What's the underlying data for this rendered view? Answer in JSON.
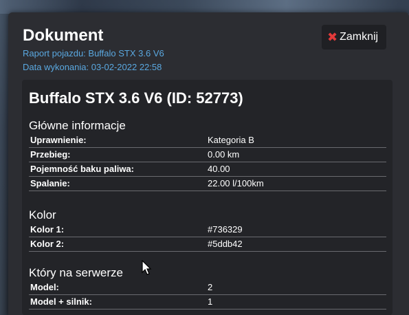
{
  "dialog": {
    "title": "Dokument",
    "report_line": "Raport pojazdu: Buffalo STX 3.6 V6",
    "date_line": "Data wykonania: 03-02-2022 22:58",
    "close_label": "Zamknij",
    "close_icon": "close-icon"
  },
  "vehicle": {
    "title": "Buffalo STX 3.6 V6 (ID: 52773)"
  },
  "sections": [
    {
      "title": "Główne informacje",
      "rows": [
        {
          "label": "Uprawnienie:",
          "value": "Kategoria B"
        },
        {
          "label": "Przebieg:",
          "value": "0.00 km"
        },
        {
          "label": "Pojemność baku paliwa:",
          "value": "40.00"
        },
        {
          "label": "Spalanie:",
          "value": "22.00 l/100km"
        }
      ]
    },
    {
      "title": "Kolor",
      "rows": [
        {
          "label": "Kolor 1:",
          "value": "#736329"
        },
        {
          "label": "Kolor 2:",
          "value": "#5ddb42"
        }
      ]
    },
    {
      "title": "Który na serwerze",
      "rows": [
        {
          "label": "Model:",
          "value": "2"
        },
        {
          "label": "Model + silnik:",
          "value": "1"
        }
      ]
    }
  ],
  "colors": {
    "accent_link": "#5aa8e0",
    "close_icon": "#e23a3a",
    "panel_bg": "#2c2d32",
    "card_bg": "#232428"
  }
}
